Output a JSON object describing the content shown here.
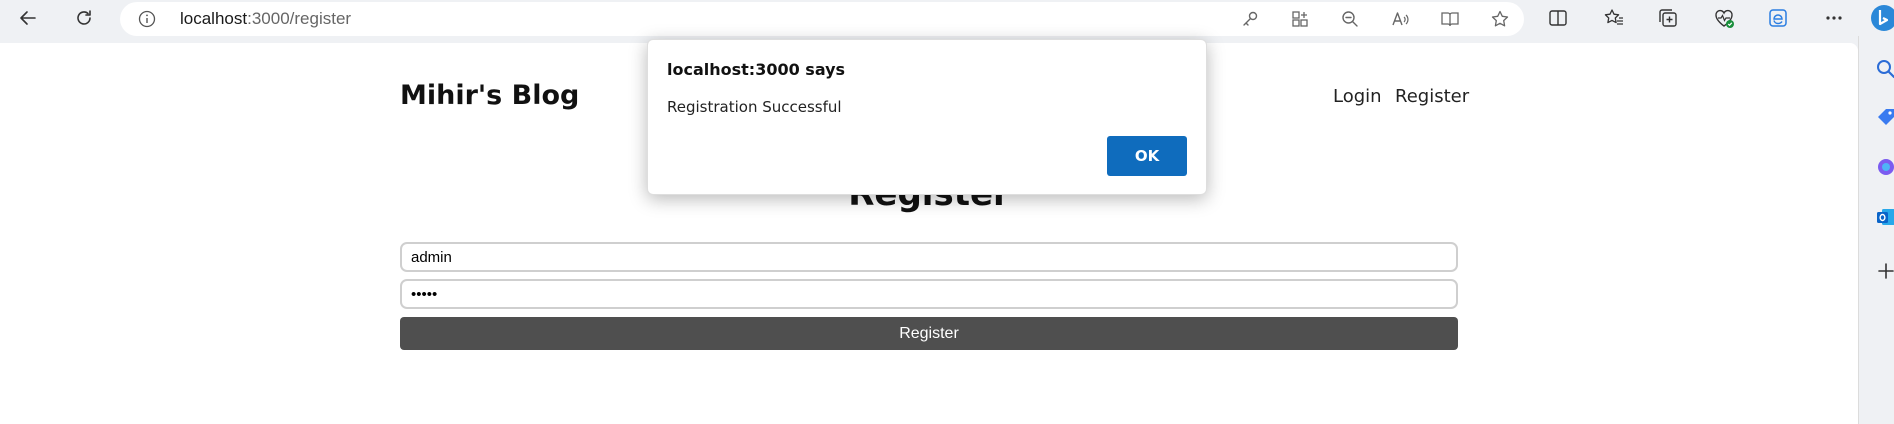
{
  "browser": {
    "address": {
      "host": "localhost",
      "path": ":3000/register"
    },
    "toolbar_icons": [
      "back-icon",
      "refresh-icon",
      "info-icon",
      "key-icon",
      "apps-icon",
      "zoom-out-icon",
      "read-aloud-icon",
      "immersive-reader-icon",
      "favorite-star-icon",
      "split-screen-icon",
      "favorites-icon",
      "collections-icon",
      "browser-essentials-icon",
      "edge-icon",
      "more-icon",
      "bing-icon"
    ],
    "sidebar_icons": [
      "search-icon",
      "tag-icon",
      "copilot-icon",
      "outlook-icon",
      "add-icon"
    ],
    "colors": {
      "chrome_bg": "#eff1f4",
      "dialog_ok": "#0f6cbd",
      "submit_bg": "#4f4f4f"
    }
  },
  "site": {
    "title": "Mihir's Blog",
    "nav": {
      "login": "Login",
      "register": "Register"
    },
    "heading": "Register",
    "form": {
      "username_value": "admin",
      "password_value": "abcde",
      "submit_label": "Register"
    }
  },
  "dialog": {
    "title": "localhost:3000 says",
    "message": "Registration Successful",
    "ok_label": "OK"
  }
}
